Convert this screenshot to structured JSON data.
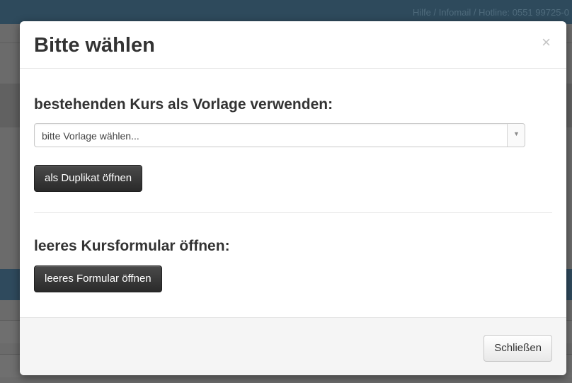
{
  "background": {
    "hotline_text": "Hilfe / Infomail / Hotline: 0551 99725-0"
  },
  "modal": {
    "title": "Bitte wählen",
    "close_glyph": "×",
    "section_template": {
      "heading": "bestehenden Kurs als Vorlage verwenden:",
      "select_value": "bitte Vorlage wählen...",
      "button_label": "als Duplikat öffnen"
    },
    "section_empty": {
      "heading": "leeres Kursformular öffnen:",
      "button_label": "leeres Formular öffnen"
    },
    "footer": {
      "close_label": "Schließen"
    }
  },
  "icons": {
    "close": "close-icon",
    "dropdown": "chevron-down-icon"
  },
  "colors": {
    "overlay_topbar": "#2e4a5c",
    "dark_button": "#333333",
    "title_text": "#333333"
  }
}
